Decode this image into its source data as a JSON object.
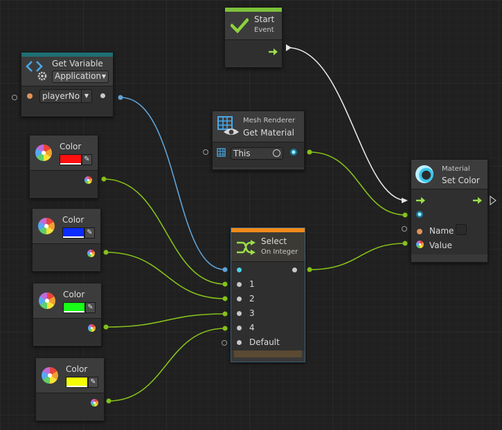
{
  "colors": {
    "canvas": "#202020",
    "wire_green": "#86c21a",
    "wire_blue": "#5fa3d8",
    "wire_white": "#e6e6e6",
    "get_variable_bar": "#1f6f74",
    "start_bar": "#7cc23a",
    "select_bar": "#f08a1a"
  },
  "start_node": {
    "title": "Start",
    "subtitle": "Event",
    "icon": "checkmark-icon"
  },
  "get_variable_node": {
    "title": "Get Variable",
    "scope": "Application",
    "variable": "playerNo",
    "icon": "variable-icon"
  },
  "mesh_renderer_node": {
    "subtitle": "Mesh Renderer",
    "title": "Get Material",
    "target": "This",
    "icon": "mesh-renderer-icon"
  },
  "set_color_node": {
    "subtitle": "Material",
    "title": "Set Color",
    "ports": [
      "Name",
      "Value"
    ],
    "icon": "material-sphere-icon"
  },
  "select_node": {
    "title": "Select",
    "subtitle": "On Integer",
    "options": [
      "1",
      "2",
      "3",
      "4",
      "Default"
    ],
    "icon": "select-icon"
  },
  "color_nodes": [
    {
      "label": "Color",
      "value": "#ff1010"
    },
    {
      "label": "Color",
      "value": "#0a2cff"
    },
    {
      "label": "Color",
      "value": "#18ff18"
    },
    {
      "label": "Color",
      "value": "#f4ff00"
    }
  ]
}
